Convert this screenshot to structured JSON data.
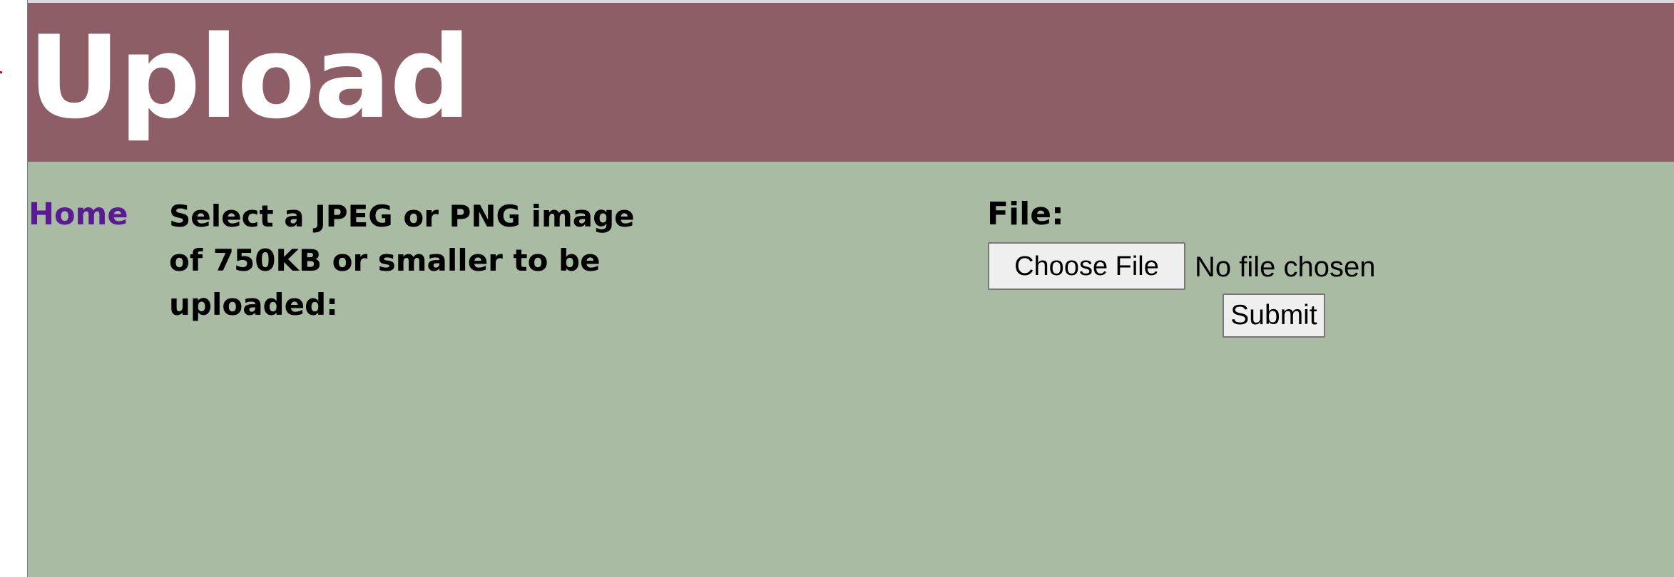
{
  "header": {
    "title": "Upload"
  },
  "nav": {
    "home_label": "Home"
  },
  "upload_form": {
    "instructions": "Select a JPEG or PNG image of 750KB or smaller to be uploaded:",
    "file_label": "File:",
    "choose_file_label": "Choose File",
    "file_status": "No file chosen",
    "submit_label": "Submit"
  },
  "colors": {
    "header_background": "#8d5e65",
    "content_background": "#a9bba3",
    "home_link": "#5a1a94",
    "title_text": "#ffffff"
  }
}
